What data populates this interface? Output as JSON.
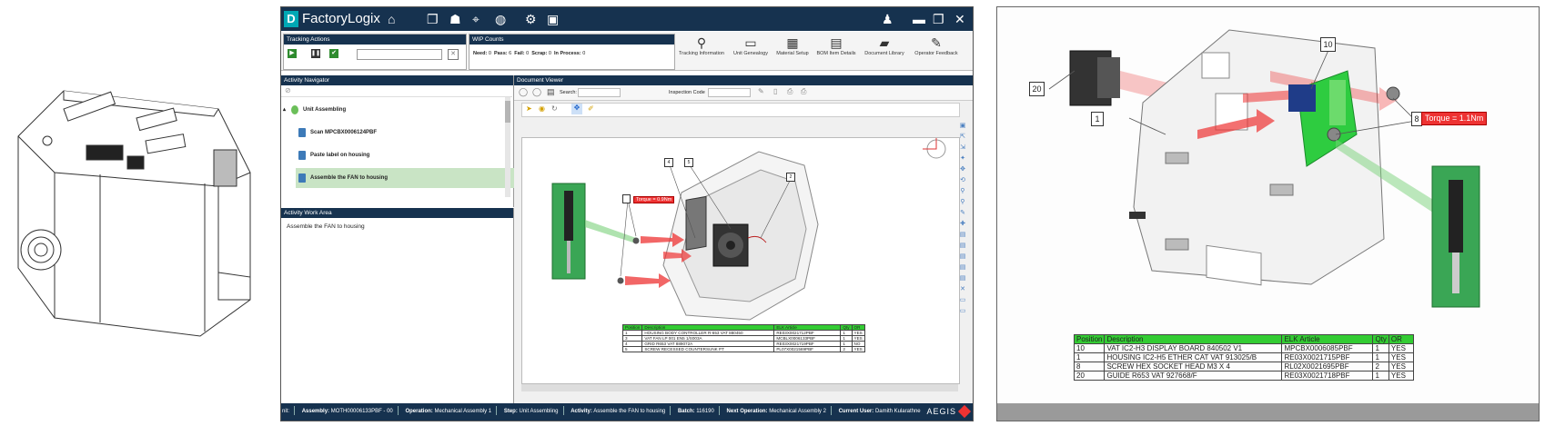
{
  "app": {
    "logo_letter": "D",
    "name": "FactoryLogix",
    "brand_footer": "AEGIS"
  },
  "tracking_actions": {
    "title": "Tracking Actions"
  },
  "wip_counts": {
    "title": "WIP Counts",
    "need_label": "Need:",
    "need_value": "0",
    "pass_label": "Pass:",
    "pass_value": "6",
    "fail_label": "Fail:",
    "fail_value": "0",
    "scrap_label": "Scrap:",
    "scrap_value": "0",
    "inprocess_label": "In Process:",
    "inprocess_value": "0"
  },
  "ribbon": [
    {
      "label": "Tracking Information",
      "icon": "binoculars-icon"
    },
    {
      "label": "Unit Genealogy",
      "icon": "genealogy-icon"
    },
    {
      "label": "Material Setup",
      "icon": "material-icon"
    },
    {
      "label": "BOM Item Details",
      "icon": "bom-icon"
    },
    {
      "label": "Document Library",
      "icon": "folder-icon"
    },
    {
      "label": "Operator Feedback",
      "icon": "feedback-icon"
    }
  ],
  "activity_navigator": {
    "title": "Activity Navigator",
    "root": "Unit Assembling",
    "items": [
      "Scan MPCBX0006124PBF",
      "Paste label on housing",
      "Assemble the FAN to housing"
    ]
  },
  "activity_work_area": {
    "title": "Activity Work Area",
    "text": "Assemble the FAN to housing"
  },
  "document_viewer": {
    "title": "Document Viewer",
    "search_label": "Search:",
    "inspection_label": "Inspection Code",
    "torque_label": "Torque = 0.9Nm",
    "callouts": [
      "4",
      "5",
      "2",
      "3"
    ],
    "bom_headers": [
      "Position",
      "Description",
      "ELK Article",
      "Qty",
      "OR"
    ],
    "bom_rows": [
      [
        "1",
        "HOUSING BODY CONTROLLER R-653 VAT 880450",
        "RE03X0021712PBF",
        "1",
        "YES"
      ],
      [
        "3",
        "VAT FAN LP 001 EN5 1/S003A",
        "MCBLX0006133PBF",
        "1",
        "YES"
      ],
      [
        "4",
        "GRID R653 VAT 889072A",
        "RE03X0021719PBF",
        "1",
        "NO"
      ],
      [
        "5",
        "SCREW RECESSED COUNTERSUNK PT",
        "PL07X0021569PBF",
        "2",
        "YES"
      ]
    ]
  },
  "status_bar": {
    "unit": "nit:",
    "assembly_label": "Assembly:",
    "assembly_value": "MOTH00006133PBF - 00",
    "operation_label": "Operation:",
    "operation_value": "Mechanical Assembly 1",
    "step_label": "Step:",
    "step_value": "Unit Assembling",
    "activity_label": "Activity:",
    "activity_value": "Assemble the FAN to housing",
    "batch_label": "Batch:",
    "batch_value": "116190",
    "next_op_label": "Next Operation:",
    "next_op_value": "Mechanical Assembly 2",
    "user_label": "Current User:",
    "user_value": "Damith Kularathne"
  },
  "right_figure": {
    "callouts": [
      "20",
      "10",
      "1",
      "8"
    ],
    "torque_label": "Torque = 1.1Nm",
    "bom_headers": [
      "Position",
      "Description",
      "ELK Article",
      "Qty",
      "OR"
    ],
    "bom_rows": [
      [
        "10",
        "VAT IC2-H3 DISPLAY BOARD 840502 V1",
        "MPCBX0006085PBF",
        "1",
        "YES"
      ],
      [
        "1",
        "HOUSING IC2-H5 ETHER CAT VAT 913025/B",
        "RE03X0021715PBF",
        "1",
        "YES"
      ],
      [
        "8",
        "SCREW HEX SOCKET HEAD M3 X 4",
        "RL02X0021695PBF",
        "2",
        "YES"
      ],
      [
        "20",
        "GUIDE R653 VAT 927668/F",
        "RE03X0021718PBF",
        "1",
        "YES"
      ]
    ]
  },
  "colors": {
    "title_bar": "#16324f",
    "accent_teal": "#00a8b5",
    "bom_header_green": "#33cc33",
    "torque_red": "#e33333",
    "selected_row": "#c9e4c5"
  }
}
